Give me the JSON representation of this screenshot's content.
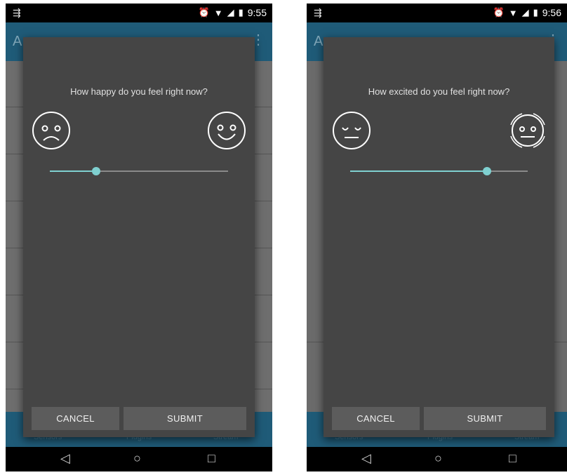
{
  "screens": [
    {
      "status": {
        "time": "9:55"
      },
      "appbar": {
        "title": "A"
      },
      "dialog": {
        "question": "How happy do you feel right now?",
        "left_face": "sad-face-icon",
        "right_face": "happy-face-icon",
        "slider_value": 0.26,
        "cancel_label": "CANCEL",
        "submit_label": "SUBMIT"
      },
      "bottomnav": {
        "items": [
          "Sensors",
          "Plugins",
          "Stream"
        ]
      }
    },
    {
      "status": {
        "time": "9:56"
      },
      "appbar": {
        "title": "A"
      },
      "dialog": {
        "question": "How excited do you feel right now?",
        "left_face": "calm-face-icon",
        "right_face": "excited-face-icon",
        "slider_value": 0.77,
        "cancel_label": "CANCEL",
        "submit_label": "SUBMIT"
      },
      "bottomnav": {
        "items": [
          "Sensors",
          "Plugins",
          "Stream"
        ]
      }
    }
  ],
  "colors": {
    "accent": "#7fd0d0",
    "appbar": "#1f5b78",
    "dialog": "#454545"
  }
}
